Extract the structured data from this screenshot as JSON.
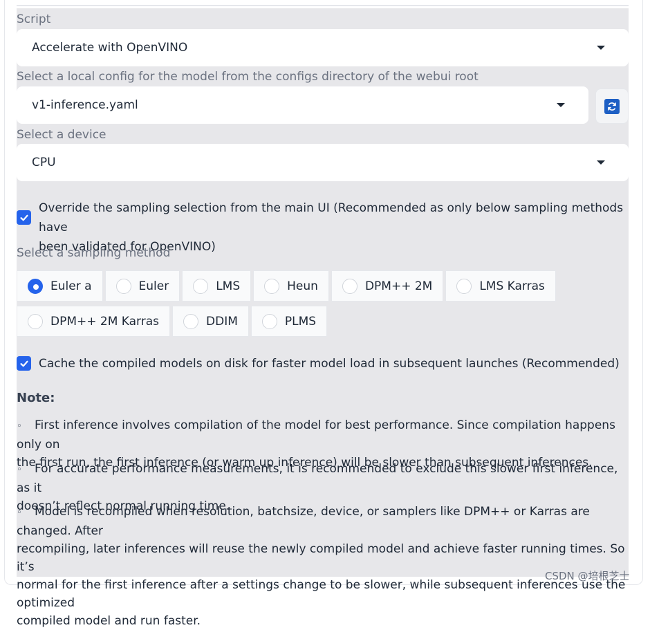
{
  "script": {
    "label": "Script",
    "value": "Accelerate with OpenVINO"
  },
  "config": {
    "label": "Select a local config for the model from the configs directory of the webui root",
    "value": "v1-inference.yaml"
  },
  "device": {
    "label": "Select a device",
    "value": "CPU"
  },
  "override": {
    "checked": true,
    "line1": "Override the sampling selection from the main UI (Recommended as only below sampling methods have",
    "line2": "been validated for OpenVINO)"
  },
  "sampling": {
    "label": "Select a sampling method",
    "options_row1": [
      "Euler a",
      "Euler",
      "LMS",
      "Heun",
      "DPM++ 2M",
      "LMS Karras"
    ],
    "options_row2": [
      "DPM++ 2M Karras",
      "DDIM",
      "PLMS"
    ],
    "selected": "Euler a"
  },
  "cache": {
    "checked": true,
    "label": "Cache the compiled models on disk for faster model load in subsequent launches (Recommended)"
  },
  "note": {
    "title": "Note:",
    "bullet": "◦",
    "item1_line1": "First inference involves compilation of the model for best performance. Since compilation happens only on",
    "item1_line2": "the first run, the first inference (or warm up inference) will be slower than subsequent inferences.",
    "item2_line1": "For accurate performance measurements, it is recommended to exclude this slower first inference, as it",
    "item2_line2": "doesn’t reflect normal running time.",
    "item3_line1": "Model is recompiled when resolution, batchsize, device, or samplers like DPM++ or Karras are changed. After",
    "item3_line2": "recompiling, later inferences will reuse the newly compiled model and achieve faster running times. So it’s",
    "item3_line3": "normal for the first inference after a settings change to be slower, while subsequent inferences use the optimized",
    "item3_line4": "compiled model and run faster."
  },
  "watermark": "CSDN @培根芝士",
  "colors": {
    "accent": "#2563eb",
    "panel": "#e7e7ea"
  }
}
